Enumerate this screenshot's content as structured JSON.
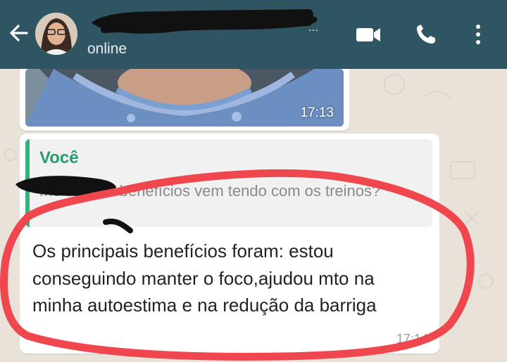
{
  "header": {
    "status": "online",
    "icons": [
      "back-arrow-icon",
      "video-call-icon",
      "phone-icon",
      "more-options-icon"
    ]
  },
  "messages": [
    {
      "type": "image",
      "time": "17:13"
    },
    {
      "type": "text",
      "quote": {
        "author": "Você",
        "text": "me diz que benefícios vem tendo com os treinos?"
      },
      "text": "Os principais benefícios foram: estou conseguindo manter o foco,ajudou mto na minha autoestima e na redução da barriga",
      "time": "17:14"
    }
  ],
  "colors": {
    "header_bg": "#2f5563",
    "chat_bg": "#e9e2d9",
    "quote_accent": "#35b07e",
    "annotation_red": "#f0474f",
    "redaction": "#111111"
  }
}
